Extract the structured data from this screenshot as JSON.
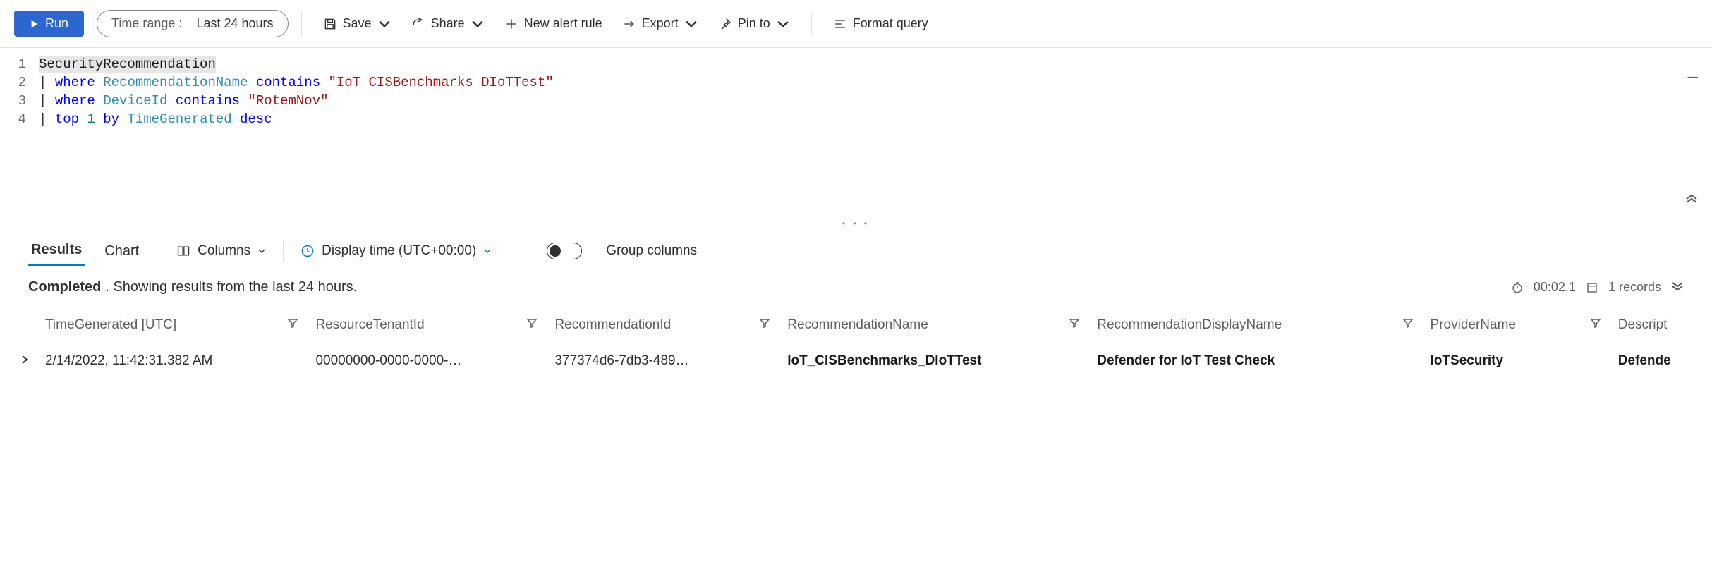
{
  "toolbar": {
    "run": "Run",
    "timeRangeLabel": "Time range :",
    "timeRangeValue": "Last 24 hours",
    "save": "Save",
    "share": "Share",
    "newAlert": "New alert rule",
    "export": "Export",
    "pinTo": "Pin to",
    "formatQuery": "Format query"
  },
  "editor": {
    "lineNumbers": [
      "1",
      "2",
      "3",
      "4"
    ],
    "lines": [
      {
        "tokens": [
          {
            "cls": "tok-table",
            "text": "SecurityRecommendation"
          }
        ]
      },
      {
        "tokens": [
          {
            "cls": "",
            "text": "| "
          },
          {
            "cls": "tok-keyword",
            "text": "where"
          },
          {
            "cls": "",
            "text": " "
          },
          {
            "cls": "tok-col",
            "text": "RecommendationName"
          },
          {
            "cls": "",
            "text": " "
          },
          {
            "cls": "tok-keyword",
            "text": "contains"
          },
          {
            "cls": "",
            "text": " "
          },
          {
            "cls": "tok-string",
            "text": "\"IoT_CISBenchmarks_DIoTTest\""
          }
        ]
      },
      {
        "tokens": [
          {
            "cls": "",
            "text": "| "
          },
          {
            "cls": "tok-keyword",
            "text": "where"
          },
          {
            "cls": "",
            "text": " "
          },
          {
            "cls": "tok-col",
            "text": "DeviceId"
          },
          {
            "cls": "",
            "text": " "
          },
          {
            "cls": "tok-keyword",
            "text": "contains"
          },
          {
            "cls": "",
            "text": " "
          },
          {
            "cls": "tok-string",
            "text": "\"RotemNov\""
          }
        ]
      },
      {
        "tokens": [
          {
            "cls": "",
            "text": "| "
          },
          {
            "cls": "tok-keyword",
            "text": "top"
          },
          {
            "cls": "",
            "text": " "
          },
          {
            "cls": "tok-num",
            "text": "1"
          },
          {
            "cls": "",
            "text": " "
          },
          {
            "cls": "tok-keyword",
            "text": "by"
          },
          {
            "cls": "",
            "text": " "
          },
          {
            "cls": "tok-col",
            "text": "TimeGenerated"
          },
          {
            "cls": "",
            "text": " "
          },
          {
            "cls": "tok-keyword",
            "text": "desc"
          }
        ]
      }
    ]
  },
  "resultsBar": {
    "tabs": {
      "results": "Results",
      "chart": "Chart"
    },
    "columns": "Columns",
    "displayTime": "Display time (UTC+00:00)",
    "groupColumns": "Group columns"
  },
  "status": {
    "completed": "Completed",
    "detail": ". Showing results from the last 24 hours.",
    "elapsed": "00:02.1",
    "records": "1 records"
  },
  "table": {
    "headers": [
      "TimeGenerated [UTC]",
      "ResourceTenantId",
      "RecommendationId",
      "RecommendationName",
      "RecommendationDisplayName",
      "ProviderName",
      "Descript"
    ],
    "rows": [
      {
        "TimeGenerated": "2/14/2022, 11:42:31.382 AM",
        "ResourceTenantId": "00000000-0000-0000-…",
        "RecommendationId": "377374d6-7db3-489…",
        "RecommendationName": "IoT_CISBenchmarks_DIoTTest",
        "RecommendationDisplayName": "Defender for IoT Test Check",
        "ProviderName": "IoTSecurity",
        "Description": "Defende"
      }
    ]
  }
}
